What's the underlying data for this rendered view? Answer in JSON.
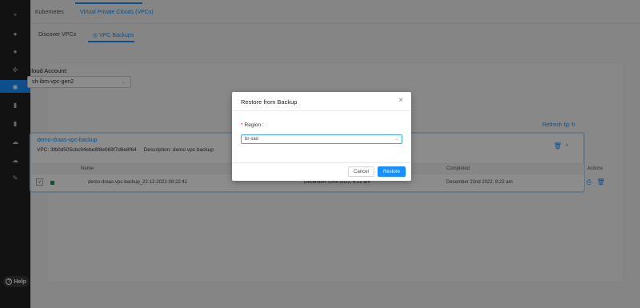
{
  "sidebar": {
    "items": [
      {
        "icon": "plus-icon",
        "glyph": "+"
      },
      {
        "icon": "cloud-icon",
        "glyph": "●"
      },
      {
        "icon": "check-circle-icon",
        "glyph": "●"
      },
      {
        "icon": "network-icon",
        "glyph": "✣"
      },
      {
        "icon": "vpc-icon",
        "glyph": "◉",
        "active": true
      },
      {
        "icon": "server-icon",
        "glyph": "▮"
      },
      {
        "icon": "storage-icon",
        "glyph": "▮"
      },
      {
        "icon": "cloud-upload-icon",
        "glyph": "☁"
      },
      {
        "icon": "cloud-download-icon",
        "glyph": "☁"
      },
      {
        "icon": "wrench-icon",
        "glyph": "✎"
      }
    ],
    "help_label": "Help"
  },
  "topnav": {
    "tabs": [
      "Kubernetes",
      "Virtual Private Clouds (VPCs)"
    ]
  },
  "subnav": {
    "tabs": [
      "Discover VPCs",
      "VPC Backups"
    ]
  },
  "cloud_account": {
    "label": "Cloud Account:",
    "value": "sh-ibm-vpc-gen2"
  },
  "refresh_label": "Refresh tip",
  "vpc": {
    "title": "demo-draas-vpc-backup",
    "vpc_label": "VPC: 3fb0d505cbc94ebe8f8e069f7d8e8f64",
    "description": "Description: demo vpc backup",
    "table": {
      "headers": [
        "Name",
        "Completed",
        "Actions"
      ],
      "row": {
        "name": "demo-draas-vpc-backup_22-12-2022-08:22:41",
        "started": "December 22nd 2022, 8:22 am",
        "completed": "December 22nd 2022, 8:22 am"
      }
    }
  },
  "modal": {
    "title": "Restore from Backup",
    "region_label": "Region :",
    "region_required": "*",
    "region_value": "br-sao",
    "cancel_label": "Cancel",
    "restore_label": "Restore"
  }
}
